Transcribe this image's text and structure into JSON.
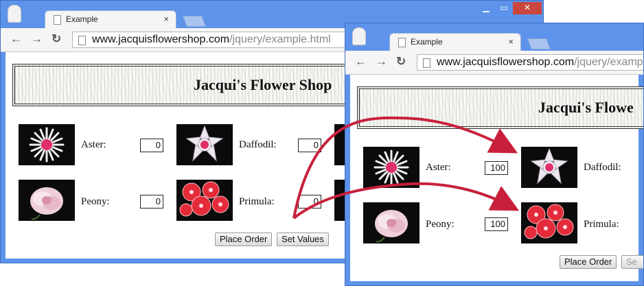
{
  "browser": {
    "tab_title": "Example",
    "tab_close": "×",
    "url_host": "www.jacquisflowershop.com",
    "url_path": "/jquery/example.html",
    "url_path_truncated": "/jquery/examp"
  },
  "window_controls": {
    "minimize": "▁",
    "maximize": "▭",
    "close": "✕"
  },
  "page": {
    "title": "Jacqui's Flower Shop",
    "title_truncated": "Jacqui's Flowe"
  },
  "flowers": [
    {
      "name": "Aster:",
      "icon": "aster-flower"
    },
    {
      "name": "Daffodil:",
      "icon": "daffodil-flower"
    },
    {
      "name": "Peony:",
      "icon": "peony-flower"
    },
    {
      "name": "Primula:",
      "icon": "primula-flower"
    }
  ],
  "before_values": {
    "aster": "0",
    "daffodil": "0",
    "peony": "0",
    "primula": "0"
  },
  "after_values": {
    "aster": "100",
    "peony": "100"
  },
  "buttons": {
    "place_order": "Place Order",
    "set_values": "Set Values",
    "set_values_truncated": "Se"
  },
  "colors": {
    "window_frame": "#5d93ea",
    "arrow": "#c8203c",
    "banner_border": "#333333"
  }
}
